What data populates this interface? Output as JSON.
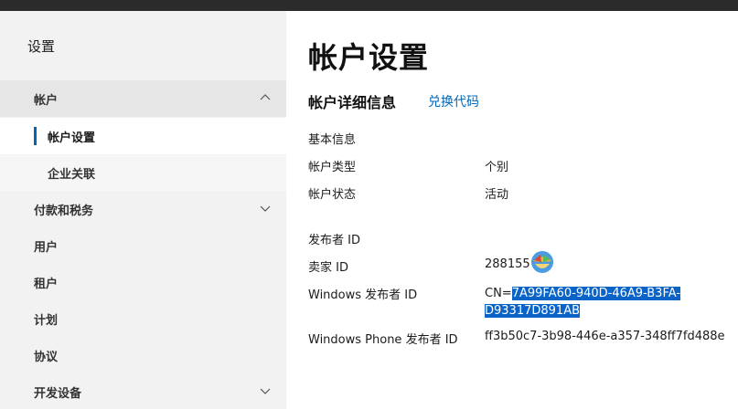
{
  "sidebar": {
    "title": "设置",
    "items": [
      {
        "label": "帐户"
      },
      {
        "label": "帐户设置"
      },
      {
        "label": "企业关联"
      },
      {
        "label": "付款和税务"
      },
      {
        "label": "用户"
      },
      {
        "label": "租户"
      },
      {
        "label": "计划"
      },
      {
        "label": "协议"
      },
      {
        "label": "开发设备"
      }
    ]
  },
  "main": {
    "title": "帐户设置",
    "section_title": "帐户详细信息",
    "redeem_link": "兑换代码",
    "basic_info": "基本信息",
    "account_type_label": "帐户类型",
    "account_type_value": "个别",
    "account_status_label": "帐户状态",
    "account_status_value": "活动",
    "publisher_id_heading": "发布者 ID",
    "seller_id_label": "卖家 ID",
    "seller_id_value": "288155",
    "windows_publisher_label": "Windows 发布者 ID",
    "windows_publisher_prefix": "CN=",
    "windows_publisher_line1": "7A99FA60-940D-46A9-B3FA-",
    "windows_publisher_line2": "D93317D891AB",
    "phone_publisher_label": "Windows Phone 发布者 ID",
    "phone_publisher_value": "ff3b50c7-3b98-446e-a357-348ff7fd488e"
  },
  "colors": {
    "accent": "#0067b8",
    "selection": "#0a64c8",
    "sidebar_bg": "#f2f2f2"
  }
}
